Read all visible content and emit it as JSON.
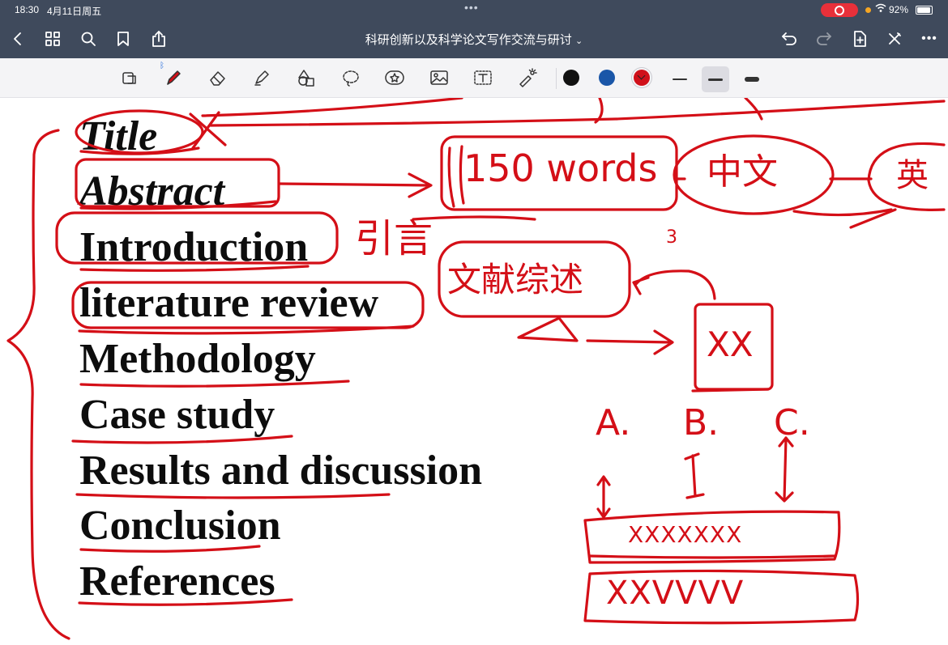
{
  "status_bar": {
    "time": "18:30",
    "date": "4月11日周五",
    "battery": "92%"
  },
  "nav": {
    "title": "科研创新以及科学论文写作交流与研讨"
  },
  "toolbar": {
    "colors": [
      "#111111",
      "#1a56a8",
      "#d0101a"
    ],
    "selected_color": "#d0101a",
    "selected_stroke": "medium"
  },
  "content": {
    "headings": [
      "Title",
      "Abstract",
      "Introduction",
      "literature review",
      "Methodology",
      "Case study",
      "Results and discussion",
      "Conclusion",
      "References"
    ],
    "annotations": {
      "abstract_words": "150 words",
      "chinese": "中文",
      "english": "英",
      "intro": "引言",
      "lit_review": "文献综述",
      "number": "3",
      "box": "XX",
      "labels": [
        "A.",
        "B.",
        "C."
      ],
      "box1": "XXXXXXX",
      "box2": "XXVVVV"
    }
  },
  "ink_color": "#d40f17"
}
